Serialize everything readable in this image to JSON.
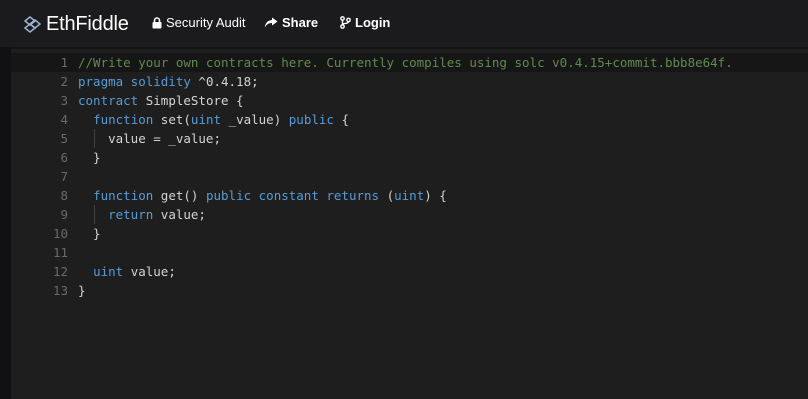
{
  "navbar": {
    "brand": "EthFiddle",
    "security_audit": "Security Audit",
    "share": "Share",
    "login": "Login"
  },
  "editor": {
    "lines": [
      {
        "n": "1",
        "tokens": [
          {
            "t": "//Write your own contracts here. Currently compiles using solc v0.4.15+commit.bbb8e64f.",
            "c": "cm"
          }
        ]
      },
      {
        "n": "2",
        "tokens": [
          {
            "t": "pragma solidity",
            "c": "kw"
          },
          {
            "t": " ^0.4.18;",
            "c": "tx"
          }
        ]
      },
      {
        "n": "3",
        "tokens": [
          {
            "t": "contract",
            "c": "kw"
          },
          {
            "t": " SimpleStore {",
            "c": "tx"
          }
        ]
      },
      {
        "n": "4",
        "tokens": [
          {
            "t": "  ",
            "c": "tx"
          },
          {
            "t": "function",
            "c": "kw"
          },
          {
            "t": " set(",
            "c": "tx"
          },
          {
            "t": "uint",
            "c": "kw"
          },
          {
            "t": " _value) ",
            "c": "tx"
          },
          {
            "t": "public",
            "c": "kw"
          },
          {
            "t": " {",
            "c": "tx"
          }
        ]
      },
      {
        "n": "5",
        "tokens": [
          {
            "t": "    value = _value;",
            "c": "tx"
          }
        ]
      },
      {
        "n": "6",
        "tokens": [
          {
            "t": "  }",
            "c": "tx"
          }
        ]
      },
      {
        "n": "7",
        "tokens": [
          {
            "t": "",
            "c": "tx"
          }
        ]
      },
      {
        "n": "8",
        "tokens": [
          {
            "t": "  ",
            "c": "tx"
          },
          {
            "t": "function",
            "c": "kw"
          },
          {
            "t": " get() ",
            "c": "tx"
          },
          {
            "t": "public constant returns",
            "c": "kw"
          },
          {
            "t": " (",
            "c": "tx"
          },
          {
            "t": "uint",
            "c": "kw"
          },
          {
            "t": ") {",
            "c": "tx"
          }
        ]
      },
      {
        "n": "9",
        "tokens": [
          {
            "t": "    ",
            "c": "tx"
          },
          {
            "t": "return",
            "c": "kw"
          },
          {
            "t": " value;",
            "c": "tx"
          }
        ]
      },
      {
        "n": "10",
        "tokens": [
          {
            "t": "  }",
            "c": "tx"
          }
        ]
      },
      {
        "n": "11",
        "tokens": [
          {
            "t": "",
            "c": "tx"
          }
        ]
      },
      {
        "n": "12",
        "tokens": [
          {
            "t": "  ",
            "c": "tx"
          },
          {
            "t": "uint",
            "c": "kw"
          },
          {
            "t": " value;",
            "c": "tx"
          }
        ]
      },
      {
        "n": "13",
        "tokens": [
          {
            "t": "}",
            "c": "tx"
          }
        ]
      }
    ]
  }
}
